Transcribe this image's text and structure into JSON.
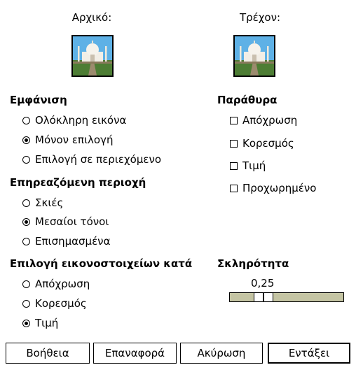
{
  "previews": {
    "original_label": "Αρχικό:",
    "current_label": "Τρέχον:"
  },
  "show": {
    "title": "Εμφάνιση",
    "options": [
      "Ολόκληρη εικόνα",
      "Μόνον επιλογή",
      "Επιλογή σε περιεχόμενο"
    ],
    "selected": 1
  },
  "windows": {
    "title": "Παράθυρα",
    "options": [
      "Απόχρωση",
      "Κορεσμός",
      "Τιμή",
      "Προχωρημένο"
    ],
    "checked": [
      false,
      false,
      false,
      false
    ]
  },
  "affected_range": {
    "title": "Επηρεαζόμενη περιοχή",
    "options": [
      "Σκιές",
      "Μεσαίοι τόνοι",
      "Επισημασμένα"
    ],
    "selected": 1
  },
  "select_pixels_by": {
    "title": "Επιλογή εικονοστοιχείων κατά",
    "options": [
      "Απόχρωση",
      "Κορεσμός",
      "Τιμή"
    ],
    "selected": 2
  },
  "roughness": {
    "title": "Σκληρότητα",
    "value_text": "0,25",
    "value": 0.25,
    "min": 0,
    "max": 1
  },
  "buttons": {
    "help": "Βοήθεια",
    "reset": "Επαναφορά",
    "cancel": "Ακύρωση",
    "ok": "Εντάξει"
  }
}
